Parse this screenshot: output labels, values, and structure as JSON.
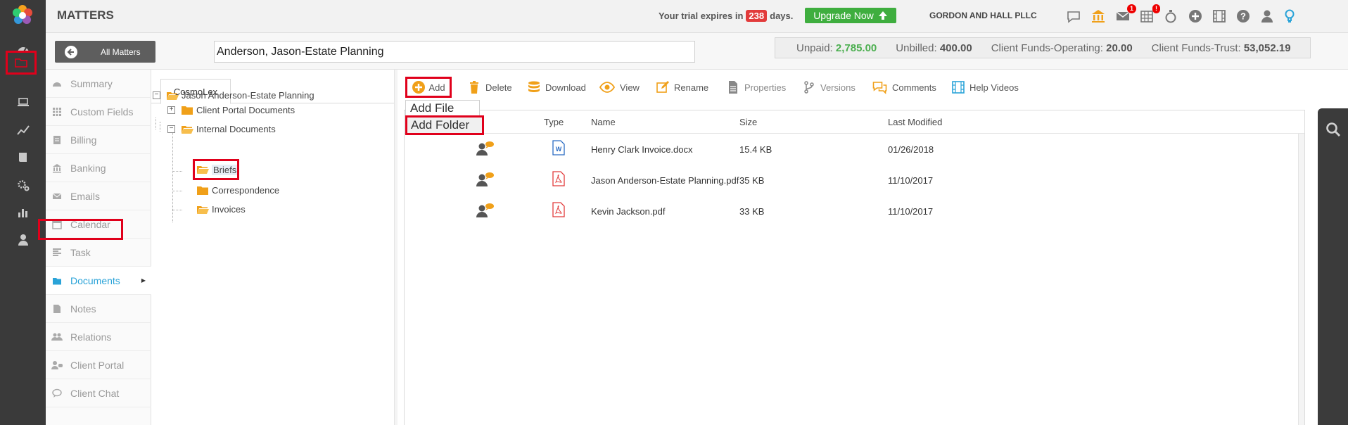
{
  "header": {
    "title": "MATTERS",
    "trial_prefix": "Your trial expires in",
    "trial_days": "238",
    "trial_suffix": "days.",
    "upgrade_label": "Upgrade Now",
    "firm_name": "GORDON AND HALL PLLC",
    "messages_badge": "1",
    "calendar_badge": "!"
  },
  "subheader": {
    "all_matters_label": "All Matters",
    "matter_value": "Anderson, Jason-Estate Planning",
    "unpaid_label": "Unpaid:",
    "unpaid_value": "2,785.00",
    "unbilled_label": "Unbilled:",
    "unbilled_value": "400.00",
    "operating_label": "Client Funds-Operating:",
    "operating_value": "20.00",
    "trust_label": "Client Funds-Trust:",
    "trust_value": "53,052.19"
  },
  "module_menu": {
    "items": [
      {
        "label": "Summary",
        "icon": "dashboard-icon"
      },
      {
        "label": "Custom Fields",
        "icon": "grid-icon"
      },
      {
        "label": "Billing",
        "icon": "billing-icon"
      },
      {
        "label": "Banking",
        "icon": "bank-icon"
      },
      {
        "label": "Emails",
        "icon": "envelope-icon"
      },
      {
        "label": "Calendar",
        "icon": "calendar-icon"
      },
      {
        "label": "Task",
        "icon": "task-icon"
      },
      {
        "label": "Documents",
        "icon": "folder-icon",
        "active": true
      },
      {
        "label": "Notes",
        "icon": "note-icon"
      },
      {
        "label": "Relations",
        "icon": "people-icon"
      },
      {
        "label": "Client Portal",
        "icon": "portal-icon"
      },
      {
        "label": "Client Chat",
        "icon": "chat-icon"
      }
    ]
  },
  "tree": {
    "tab_label": "CosmoLex",
    "root": "Jason Anderson-Estate Planning",
    "client_portal": "Client Portal Documents",
    "internal": "Internal Documents",
    "briefs": "Briefs",
    "correspondence": "Correspondence",
    "invoices": "Invoices"
  },
  "toolbar": {
    "add": "Add",
    "delete": "Delete",
    "download": "Download",
    "view": "View",
    "rename": "Rename",
    "properties": "Properties",
    "versions": "Versions",
    "comments": "Comments",
    "help_videos": "Help Videos"
  },
  "add_menu": {
    "add_file": "Add File",
    "add_folder": "Add Folder"
  },
  "table": {
    "columns": [
      "Type",
      "Name",
      "Size",
      "Last Modified"
    ],
    "rows": [
      {
        "type": "word",
        "name": "Henry Clark Invoice.docx",
        "size": "15.4 KB",
        "modified": "01/26/2018"
      },
      {
        "type": "pdf",
        "name": "Jason Anderson-Estate Planning.pdf",
        "size": "35 KB",
        "modified": "11/10/2017"
      },
      {
        "type": "pdf",
        "name": "Kevin Jackson.pdf",
        "size": "33 KB",
        "modified": "11/10/2017"
      }
    ]
  },
  "colors": {
    "accent_orange": "#f0a019",
    "highlight_red": "#e0001b",
    "active_blue": "#2aa3d8",
    "upgrade_green": "#3fae3f",
    "unpaid_green": "#4caf50",
    "rail_dark": "#3a3a3a"
  }
}
